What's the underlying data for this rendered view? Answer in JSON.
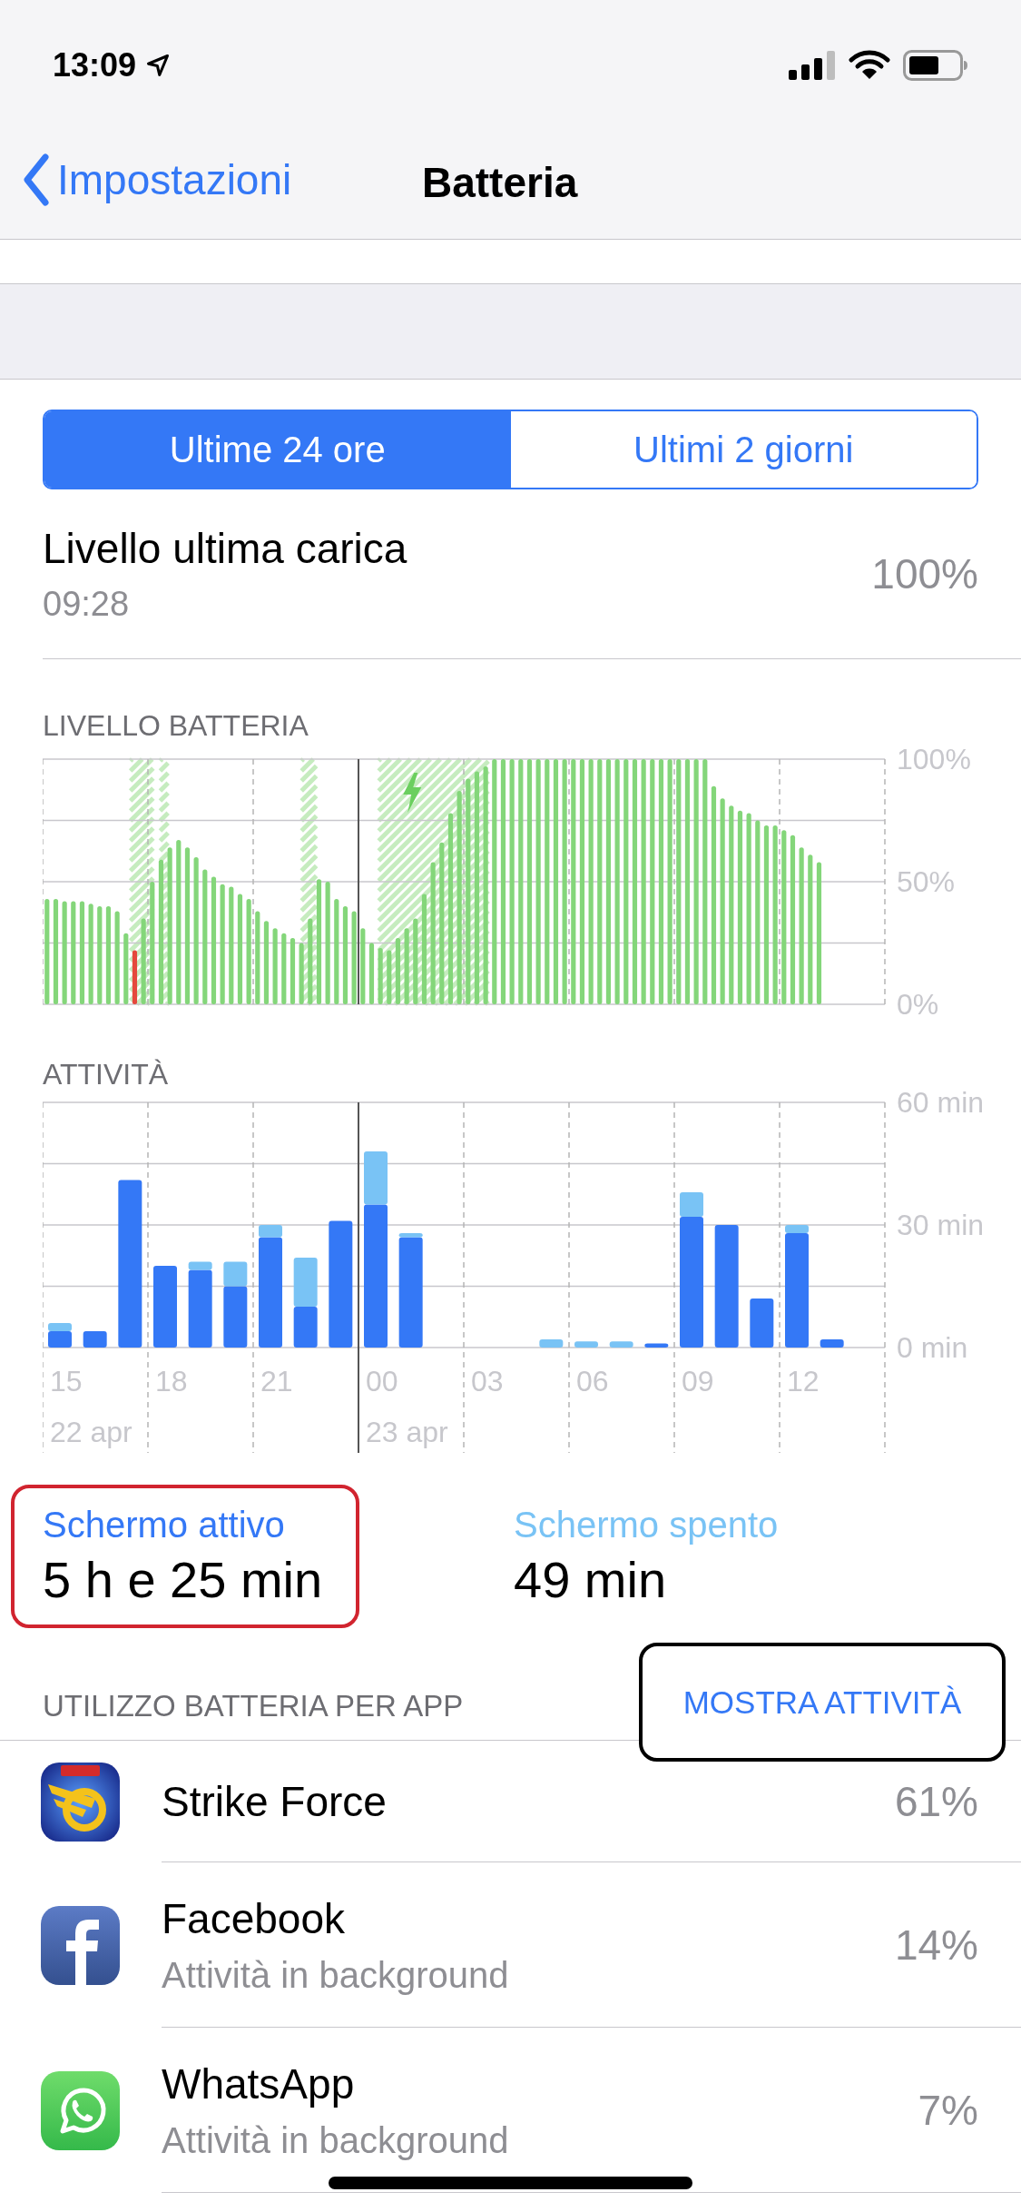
{
  "status_bar": {
    "time": "13:09"
  },
  "nav": {
    "back": "Impostazioni",
    "title": "Batteria"
  },
  "tabs": [
    {
      "label": "Ultime 24 ore",
      "selected": true
    },
    {
      "label": "Ultimi 2 giorni",
      "selected": false
    }
  ],
  "last_charge": {
    "label": "Livello ultima carica",
    "time": "09:28",
    "value": "100%"
  },
  "battery_level": {
    "title": "LIVELLO BATTERIA",
    "chart_data": {
      "type": "bar",
      "ylim": [
        0,
        100
      ],
      "yticks": [
        {
          "value": 0,
          "label": "0%"
        },
        {
          "value": 50,
          "label": "50%"
        },
        {
          "value": 100,
          "label": "100%"
        }
      ],
      "series": [
        {
          "color": "#84d67a",
          "values": [
            43,
            43,
            42,
            42,
            42,
            41,
            40,
            40,
            38,
            29,
            null,
            35,
            50,
            59,
            64,
            67,
            64,
            60,
            55,
            52,
            49,
            48,
            45,
            43,
            38,
            34,
            31,
            29,
            27,
            25,
            35,
            51,
            50,
            43,
            40,
            38,
            31,
            25,
            23,
            22,
            27,
            31,
            35,
            45,
            58,
            66,
            78,
            87,
            92,
            95,
            97,
            100,
            100,
            100,
            100,
            100,
            100,
            100,
            100,
            100,
            100,
            100,
            100,
            100,
            100,
            100,
            100,
            100,
            100,
            100,
            100,
            100,
            100,
            100,
            100,
            100,
            89,
            84,
            81,
            79,
            78,
            75,
            73,
            73,
            71,
            69,
            64,
            61,
            58,
            null,
            null,
            null,
            null,
            null,
            null,
            null
          ]
        },
        {
          "color": "#e5483d",
          "values": [
            null,
            null,
            null,
            null,
            null,
            null,
            null,
            null,
            null,
            null,
            22,
            null,
            null,
            null,
            null,
            null,
            null,
            null,
            null,
            null,
            null,
            null,
            null,
            null,
            null,
            null,
            null,
            null,
            null,
            null,
            null,
            null,
            null,
            null,
            null,
            null,
            null,
            null,
            null,
            null,
            null,
            null,
            null,
            null,
            null,
            null,
            null,
            null,
            null,
            null,
            null,
            null,
            null,
            null,
            null,
            null,
            null,
            null,
            null,
            null,
            null,
            null,
            null,
            null,
            null,
            null,
            null,
            null,
            null,
            null,
            null,
            null,
            null,
            null,
            null,
            null,
            null,
            null,
            null,
            null,
            null,
            null,
            null,
            null,
            null,
            null,
            null,
            null,
            null,
            null,
            null,
            null,
            null,
            null,
            null,
            null
          ]
        }
      ]
    }
  },
  "activity": {
    "title": "ATTIVITÀ",
    "chart_data": {
      "type": "bar",
      "stacked": true,
      "ylim": [
        0,
        60
      ],
      "yticks": [
        {
          "value": 0,
          "label": "0 min"
        },
        {
          "value": 30,
          "label": "30 min"
        },
        {
          "value": 60,
          "label": "60 min"
        }
      ],
      "categories": [
        "15",
        null,
        null,
        "18",
        null,
        null,
        "21",
        null,
        null,
        "00",
        null,
        null,
        "03",
        null,
        null,
        "06",
        null,
        null,
        "09",
        null,
        null,
        "12",
        null,
        null
      ],
      "series": [
        {
          "color": "#3478f6",
          "values": [
            4,
            4,
            41,
            20,
            19,
            15,
            27,
            10,
            31,
            35,
            27,
            0,
            0,
            0,
            0,
            0,
            0,
            1,
            32,
            30,
            12,
            28,
            2,
            null
          ]
        },
        {
          "color": "#79c3f5",
          "values": [
            2,
            0,
            0,
            0,
            2,
            6,
            3,
            12,
            0,
            13,
            1,
            0,
            0,
            0,
            2,
            1.5,
            1.5,
            0,
            6,
            0,
            0,
            2,
            0,
            null
          ]
        }
      ]
    },
    "dates": [
      "22 apr",
      "23 apr"
    ]
  },
  "summary": [
    {
      "label": "Schermo attivo",
      "value": "5 h e 25 min",
      "color": "#3478f6",
      "highlighted": true
    },
    {
      "label": "Schermo spento",
      "value": "49 min",
      "color": "#79c3f5",
      "highlighted": false
    }
  ],
  "apps_section": {
    "title": "UTILIZZO BATTERIA PER APP",
    "action": "MOSTRA ATTIVITÀ",
    "action_highlighted": true
  },
  "apps": [
    {
      "kind": "game",
      "name": "Strike Force",
      "value": "61%"
    },
    {
      "kind": "facebook",
      "name": "Facebook",
      "subtitle": "Attività in background",
      "value": "14%"
    },
    {
      "kind": "whatsapp",
      "name": "WhatsApp",
      "subtitle": "Attività in background",
      "value": "7%"
    }
  ]
}
